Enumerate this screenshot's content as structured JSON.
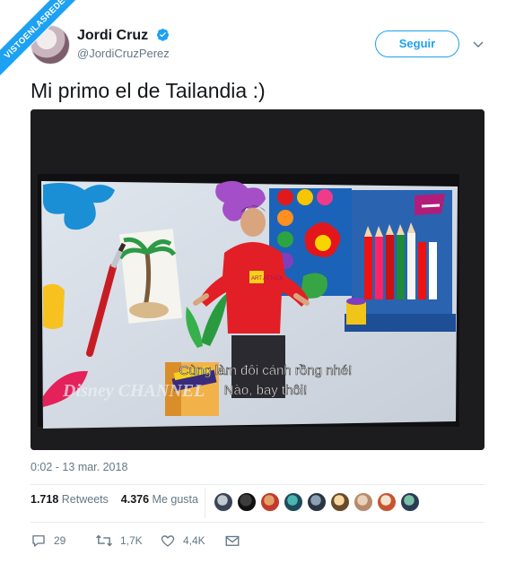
{
  "watermark": "VISTOENLASREDES",
  "author": {
    "name": "Jordi Cruz",
    "handle": "@JordiCruzPerez"
  },
  "follow_label": "Seguir",
  "tweet_text": "Mi primo el de Tailandia :)",
  "media": {
    "subtitle_line1": "Cùng làm đôi cánh rồng nhé!",
    "subtitle_line2": "Nào, bay thôi!",
    "channel_logo": "Disney CHANNEL",
    "shirt_text": "ART ATTACK"
  },
  "timestamp": "0:02 - 13 mar. 2018",
  "stats": {
    "retweets_count": "1.718",
    "retweets_label": "Retweets",
    "likes_count": "4.376",
    "likes_label": "Me gusta"
  },
  "actions": {
    "replies": "29",
    "retweets": "1,7K",
    "likes": "4,4K"
  },
  "colors": {
    "accent": "#1da1f2",
    "muted": "#657786"
  }
}
